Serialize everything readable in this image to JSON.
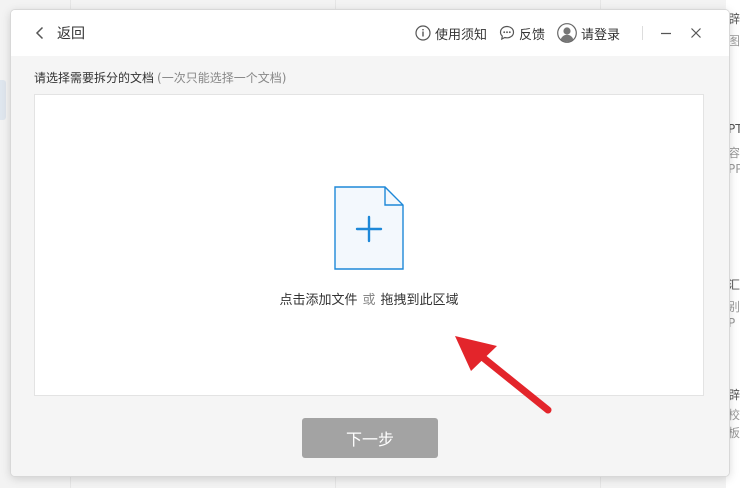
{
  "titlebar": {
    "back_label": "返回",
    "notice_label": "使用须知",
    "feedback_label": "反馈",
    "login_label": "请登录"
  },
  "content": {
    "prompt": "请选择需要拆分的文档",
    "prompt_hint": "(一次只能选择一个文档)",
    "drop_click_text": "点击添加文件",
    "drop_or_text": "或",
    "drop_drag_text": "拖拽到此区域",
    "next_button_label": "下一步"
  },
  "background": {
    "fragments": [
      "辟P",
      "图",
      "PT",
      "容",
      "PP",
      "汇彡",
      "别",
      "P",
      "辟肚",
      "校",
      "板"
    ]
  },
  "colors": {
    "accent": "#1e88d8",
    "annotation_arrow": "#e3252b",
    "disabled_button": "#a3a3a3"
  }
}
